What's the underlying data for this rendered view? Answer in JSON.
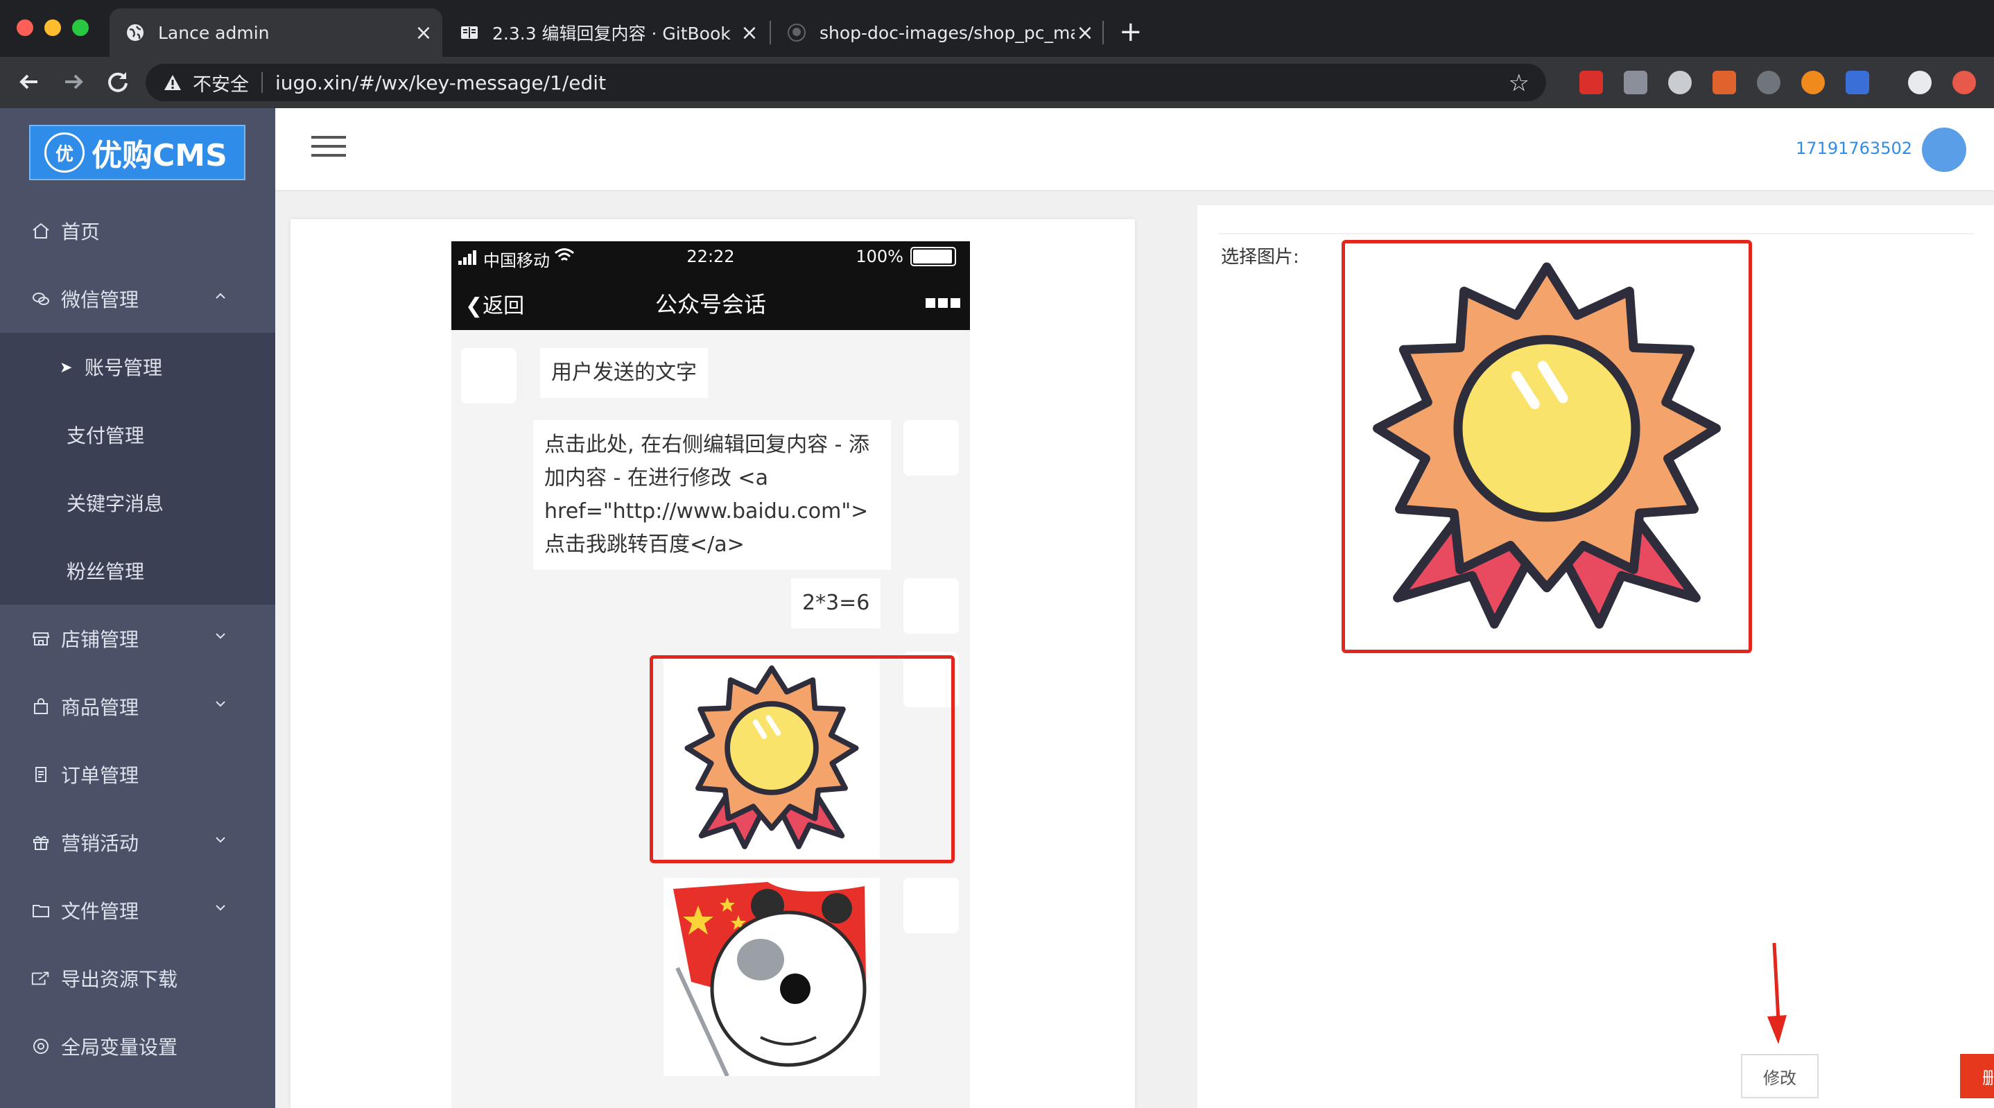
{
  "browser": {
    "tabs": [
      {
        "title": "Lance admin",
        "active": true
      },
      {
        "title": "2.3.3 编辑回复内容 · GitBook",
        "active": false
      },
      {
        "title": "shop-doc-images/shop_pc_ma",
        "active": false
      }
    ],
    "security_label": "不安全",
    "url": "iugo.xin/#/wx/key-message/1/edit",
    "close_glyph": "×",
    "new_tab_glyph": "+"
  },
  "sidebar": {
    "logo_mark": "优",
    "logo_text": "优购CMS",
    "items": [
      {
        "label": "首页",
        "icon": "home-icon"
      },
      {
        "label": "微信管理",
        "icon": "wechat-icon",
        "expanded": true
      },
      {
        "label": "账号管理",
        "sub": true,
        "current": true
      },
      {
        "label": "支付管理",
        "sub": true
      },
      {
        "label": "关键字消息",
        "sub": true
      },
      {
        "label": "粉丝管理",
        "sub": true
      },
      {
        "label": "店铺管理",
        "icon": "shop-icon"
      },
      {
        "label": "商品管理",
        "icon": "bag-icon"
      },
      {
        "label": "订单管理",
        "icon": "order-icon"
      },
      {
        "label": "营销活动",
        "icon": "gift-icon"
      },
      {
        "label": "文件管理",
        "icon": "folder-icon"
      },
      {
        "label": "导出资源下载",
        "icon": "export-icon"
      },
      {
        "label": "全局变量设置",
        "icon": "settings-icon"
      }
    ]
  },
  "header": {
    "user_phone": "17191763502"
  },
  "phone": {
    "carrier": "中国移动",
    "time": "22:22",
    "battery": "100%",
    "back_label": "返回",
    "title": "公众号会话",
    "messages": {
      "user_text": "用户发送的文字",
      "reply_text": "点击此处, 在右侧编辑回复内容 - 添加内容 - 在进行修改 <a href=\"http://www.baidu.com\"> 点击我跳转百度</a>",
      "math_text": "2*3=6"
    }
  },
  "editor": {
    "choose_image_label": "选择图片:",
    "edit_button": "修改",
    "delete_button": "删除"
  },
  "colors": {
    "accent_blue": "#2f8ce8",
    "sidebar_bg": "#4b5268",
    "danger_red": "#e5381c",
    "highlight_red": "#e3271c"
  }
}
